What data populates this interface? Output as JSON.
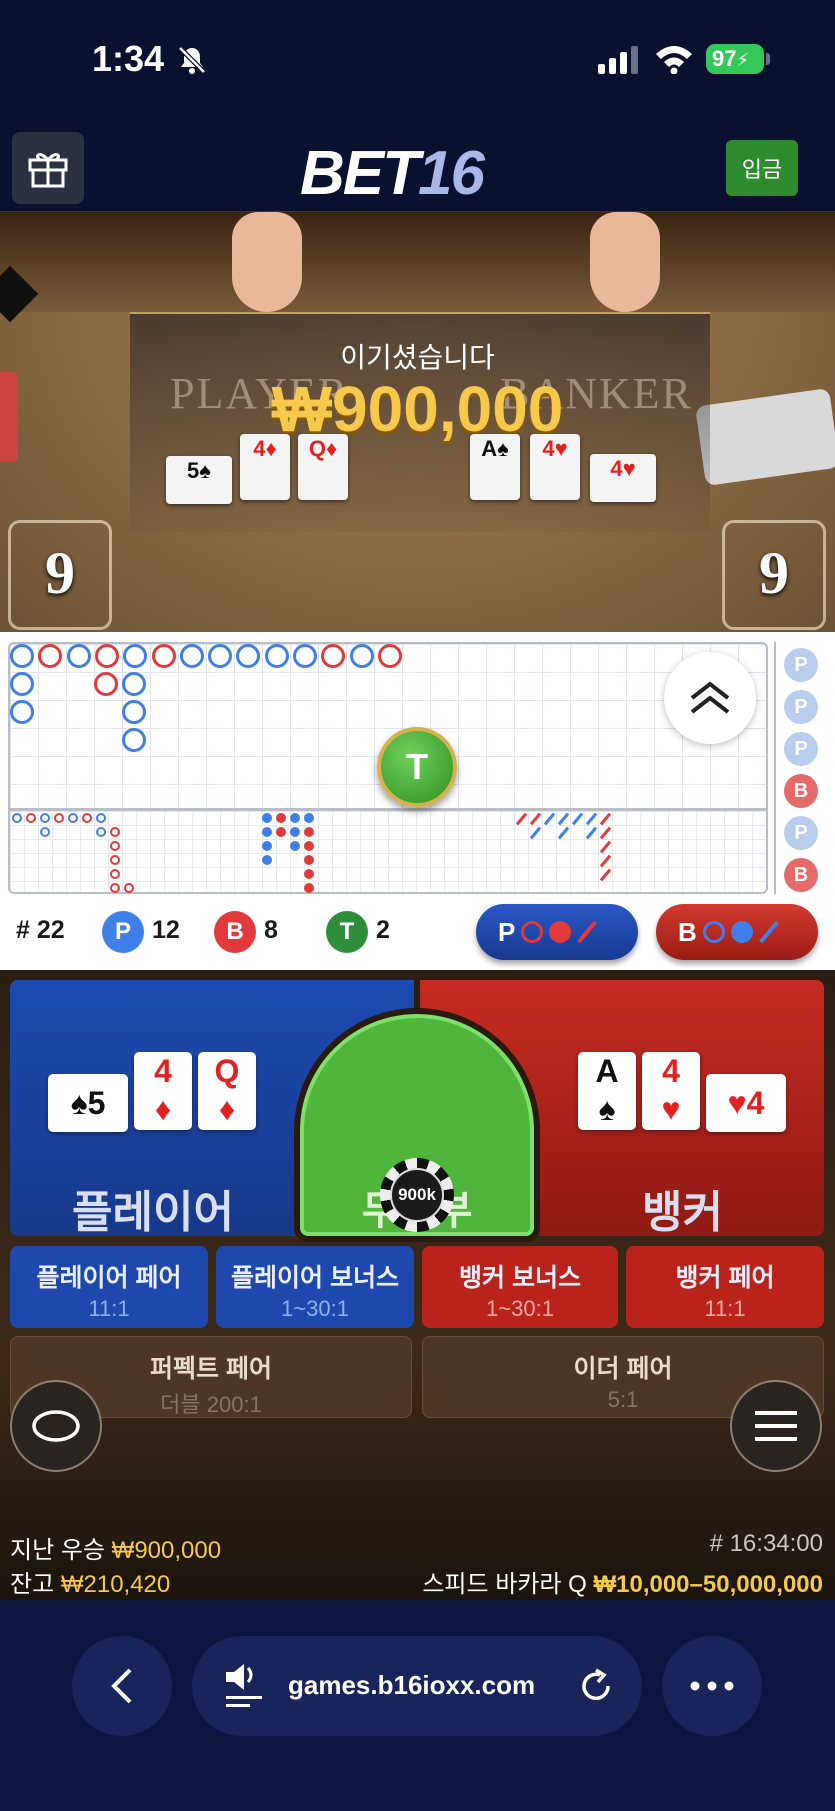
{
  "status_bar": {
    "time": "1:34",
    "battery": "97"
  },
  "header": {
    "logo_main": "BET",
    "logo_num": "16",
    "deposit_label": "입금"
  },
  "video": {
    "win_message": "이기셨습니다",
    "win_amount": "₩900,000",
    "player_label": "PLAYER",
    "banker_label": "BANKER",
    "player_score": "9",
    "banker_score": "9",
    "player_cards": [
      "5♠",
      "4♦",
      "Q♦"
    ],
    "banker_cards": [
      "A♠",
      "4♥",
      "4♥"
    ]
  },
  "roadmap": {
    "tie_marker": "T",
    "side_beads": [
      "P",
      "P",
      "P",
      "B",
      "P",
      "B"
    ]
  },
  "stats": {
    "total_label": "# 22",
    "player_icon": "P",
    "player_count": "12",
    "banker_icon": "B",
    "banker_count": "8",
    "tie_icon": "T",
    "tie_count": "2",
    "predict_player": "P",
    "predict_banker": "B"
  },
  "betting": {
    "player_label": "플레이어",
    "banker_label": "뱅커",
    "tie_label": "무승부",
    "chip_value": "900k",
    "player_cards": [
      {
        "rank": "5",
        "suit": "♠"
      },
      {
        "rank": "4",
        "suit": "♦"
      },
      {
        "rank": "Q",
        "suit": "♦"
      }
    ],
    "banker_cards": [
      {
        "rank": "A",
        "suit": "♠"
      },
      {
        "rank": "4",
        "suit": "♥"
      },
      {
        "rank": "4",
        "suit": "♥"
      }
    ],
    "side_bets": [
      {
        "title": "플레이어 페어",
        "odds": "11:1"
      },
      {
        "title": "플레이어 보너스",
        "odds": "1~30:1"
      },
      {
        "title": "뱅커 보너스",
        "odds": "1~30:1"
      },
      {
        "title": "뱅커 페어",
        "odds": "11:1"
      },
      {
        "title": "퍼펙트 페어",
        "odds": "더블 200:1"
      },
      {
        "title": "이더 페어",
        "odds": "5:1"
      }
    ]
  },
  "info": {
    "last_win_label": "지난 우승",
    "last_win_value": "₩900,000",
    "balance_label": "잔고",
    "balance_value": "₩210,420",
    "round_id": "# 16:34:00",
    "table_name": "스피드 바카라 Q",
    "bet_limits": "₩10,000–50,000,000"
  },
  "browser": {
    "url": "games.b16ioxx.com"
  },
  "colors": {
    "player_blue": "#1d4bb2",
    "banker_red": "#c52b22",
    "tie_green": "#4fb63b",
    "gold": "#f6c84c"
  }
}
